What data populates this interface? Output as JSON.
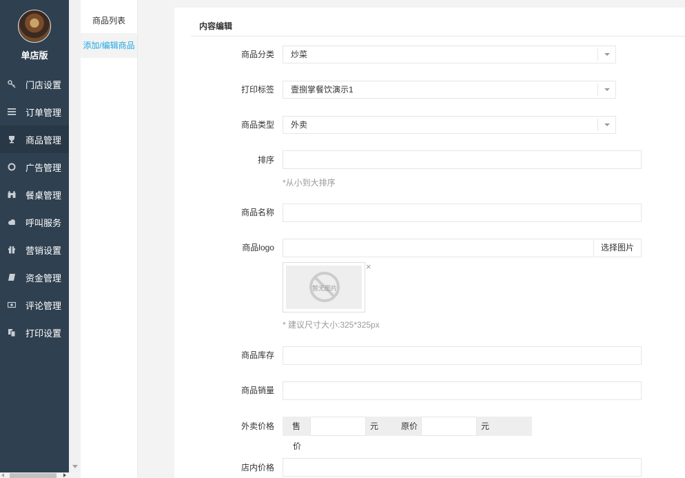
{
  "brand": {
    "name": "单店版"
  },
  "nav": [
    {
      "id": "store",
      "label": "门店设置",
      "icon": "key-icon"
    },
    {
      "id": "orders",
      "label": "订单管理",
      "icon": "list-icon"
    },
    {
      "id": "goods",
      "label": "商品管理",
      "icon": "trophy-icon",
      "active": true
    },
    {
      "id": "ads",
      "label": "广告管理",
      "icon": "lifebuoy-icon"
    },
    {
      "id": "tables",
      "label": "餐桌管理",
      "icon": "binoculars-icon"
    },
    {
      "id": "call",
      "label": "呼叫服务",
      "icon": "cloud-icon"
    },
    {
      "id": "marketing",
      "label": "营销设置",
      "icon": "gift-icon"
    },
    {
      "id": "funds",
      "label": "资金管理",
      "icon": "book-icon"
    },
    {
      "id": "reviews",
      "label": "评论管理",
      "icon": "money-icon"
    },
    {
      "id": "print",
      "label": "打印设置",
      "icon": "copy-icon"
    }
  ],
  "submenu": [
    {
      "label": "商品列表",
      "active": false
    },
    {
      "label": "添加/编辑商品",
      "active": true
    }
  ],
  "form": {
    "title": "内容编辑",
    "category": {
      "label": "商品分类",
      "value": "炒菜"
    },
    "print_tag": {
      "label": "打印标签",
      "value": "壹捌掌餐饮演示1"
    },
    "goods_type": {
      "label": "商品类型",
      "value": "外卖"
    },
    "sort": {
      "label": "排序",
      "value": "",
      "help": "*从小到大排序"
    },
    "name": {
      "label": "商品名称",
      "value": ""
    },
    "logo": {
      "label": "商品logo",
      "value": "",
      "button": "选择图片",
      "placeholder_text": "暂无图片",
      "remove": "×",
      "help": "* 建议尺寸大小:325*325px"
    },
    "stock": {
      "label": "商品库存",
      "value": ""
    },
    "sales": {
      "label": "商品销量",
      "value": ""
    },
    "takeout_price": {
      "label": "外卖价格",
      "sale_label_1": "售",
      "sale_label_2": "价",
      "sale_value": "",
      "unit_1": "元",
      "orig_label": "原价",
      "orig_value": "",
      "unit_2": "元"
    },
    "dinein_price": {
      "label": "店内价格",
      "value": ""
    }
  }
}
